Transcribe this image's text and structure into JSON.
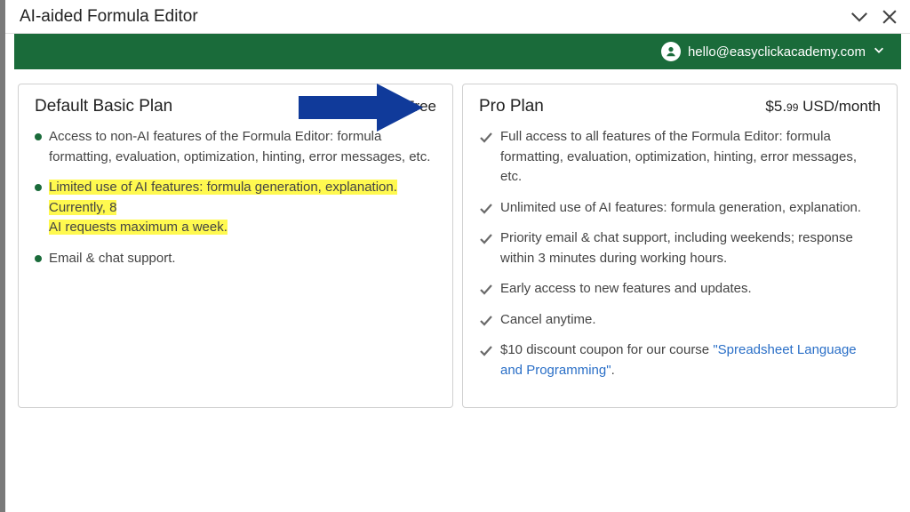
{
  "window": {
    "title": "AI-aided Formula Editor"
  },
  "account": {
    "email": "hello@easyclickacademy.com"
  },
  "basic": {
    "name": "Default Basic Plan",
    "price": "Free",
    "features": {
      "f0": "Access to non-AI features of the Formula Editor: formula formatting, evaluation, optimization, hinting, error messages, etc.",
      "f1a": "Limited use of AI features: formula generation, explanation. Currently, 8",
      "f1b": "AI requests maximum a week.",
      "f2": "Email & chat support."
    }
  },
  "pro": {
    "name": "Pro Plan",
    "price_whole": "$5.",
    "price_cents": "99",
    "price_suffix": " USD/month",
    "features": {
      "f0": "Full access to all features of the Formula Editor: formula formatting, evaluation, optimization, hinting, error messages, etc.",
      "f1": "Unlimited use of AI features: formula generation, explanation.",
      "f2": "Priority email & chat support, including weekends; response within 3 minutes during working hours.",
      "f3": "Early access to new features and updates.",
      "f4": "Cancel anytime.",
      "f5_pre": "$10 discount coupon for our course ",
      "f5_link": "\"Spreadsheet Language and Programming\"",
      "f5_post": "."
    }
  },
  "colors": {
    "brand_green": "#1a6b3a",
    "arrow_blue": "#103a9a",
    "highlight_yellow": "#fff94f"
  }
}
